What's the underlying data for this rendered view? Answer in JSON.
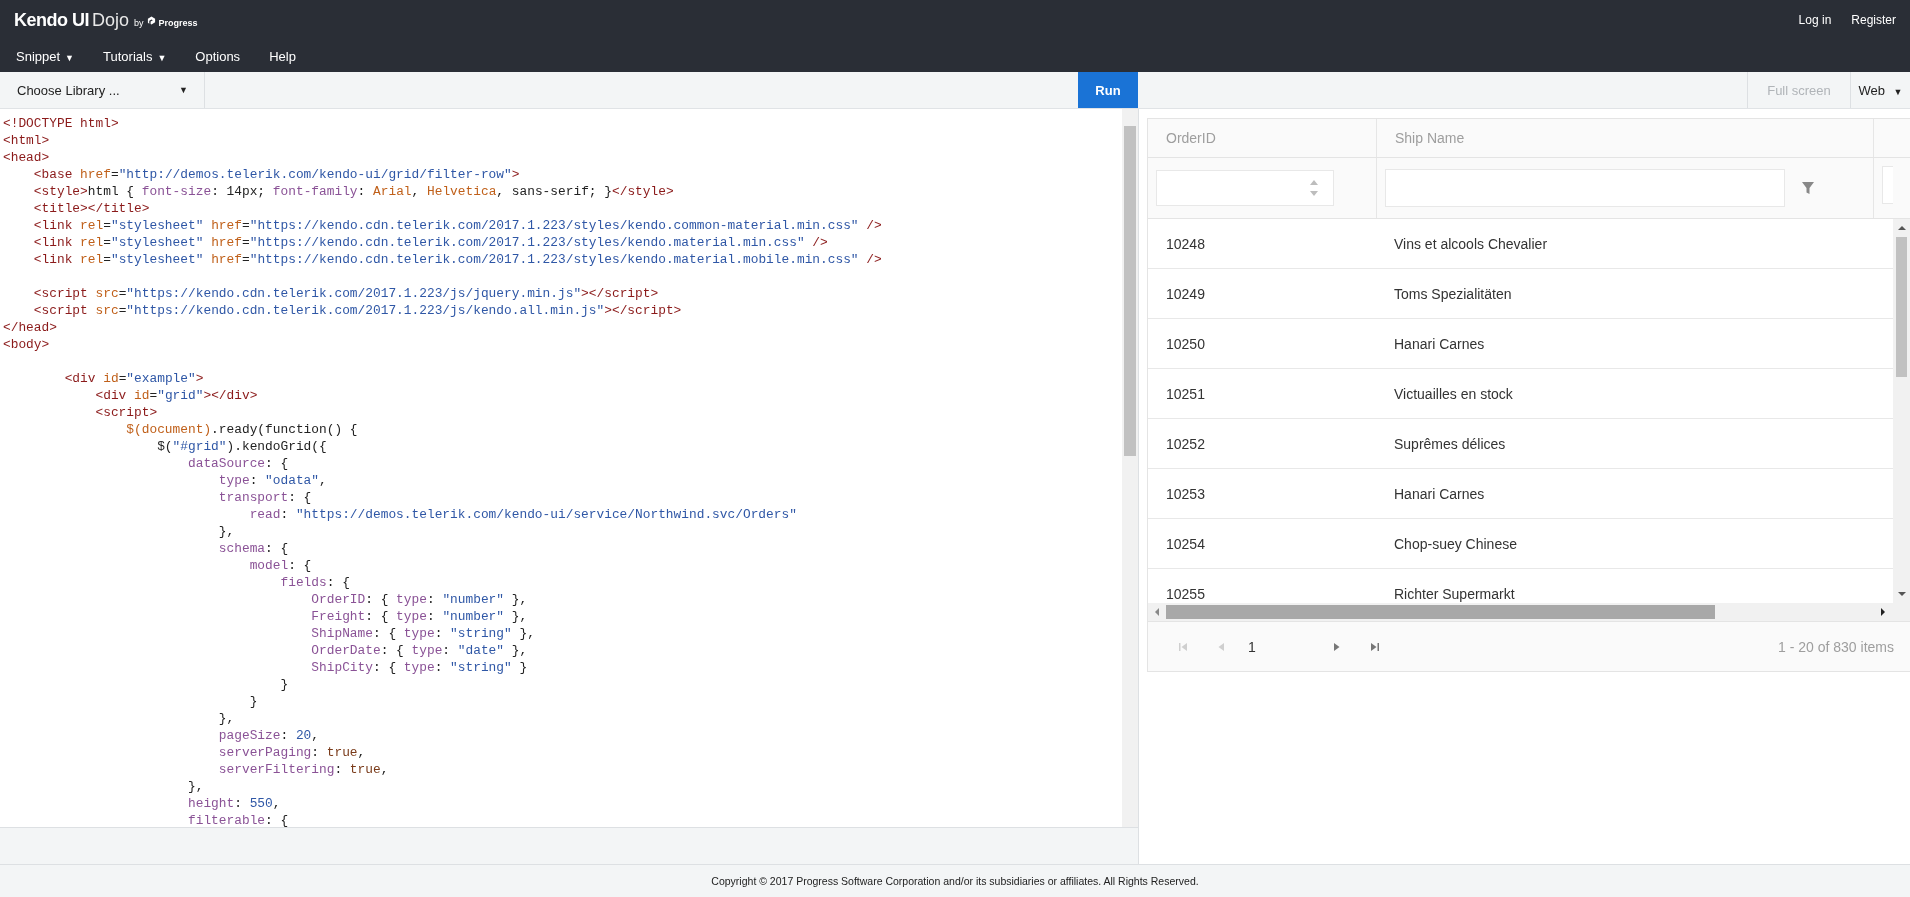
{
  "brand": {
    "name": "Kendo UI",
    "product": "Dojo",
    "by": "by",
    "company": "Progress"
  },
  "account_links": [
    "Log in",
    "Register"
  ],
  "menu": [
    {
      "label": "Snippet",
      "caret": "▼"
    },
    {
      "label": "Tutorials",
      "caret": "▼"
    },
    {
      "label": "Options"
    },
    {
      "label": "Help"
    }
  ],
  "toolbar": {
    "library": {
      "label": "Choose Library ...",
      "caret": "▼"
    },
    "run": "Run",
    "full_screen": {
      "label": "Full screen",
      "disabled": true
    },
    "view": {
      "label": "Web",
      "caret": "▼"
    }
  },
  "code_lines": [
    {
      "tokens": [
        {
          "kind": "tag",
          "text": "<!DOCTYPE html>"
        }
      ]
    },
    {
      "tokens": [
        {
          "kind": "tag",
          "text": "<html>"
        }
      ]
    },
    {
      "tokens": [
        {
          "kind": "tag",
          "text": "<head>"
        }
      ]
    },
    {
      "tokens": [
        {
          "kind": "tag",
          "text": "    <base "
        },
        {
          "kind": "attr",
          "text": "href"
        },
        {
          "kind": "plain",
          "text": "="
        },
        {
          "kind": "str",
          "text": "\"http://demos.telerik.com/kendo-ui/grid/filter-row\""
        },
        {
          "kind": "tag",
          "text": ">"
        }
      ]
    },
    {
      "tokens": [
        {
          "kind": "tag",
          "text": "    <style>"
        },
        {
          "kind": "plain",
          "text": "html { "
        },
        {
          "kind": "prop",
          "text": "font-size"
        },
        {
          "kind": "plain",
          "text": ": 14px; "
        },
        {
          "kind": "prop",
          "text": "font-family"
        },
        {
          "kind": "plain",
          "text": ": "
        },
        {
          "kind": "attr",
          "text": "Arial"
        },
        {
          "kind": "plain",
          "text": ", "
        },
        {
          "kind": "attr",
          "text": "Helvetica"
        },
        {
          "kind": "plain",
          "text": ", sans-serif; }"
        },
        {
          "kind": "tag",
          "text": "</style>"
        }
      ]
    },
    {
      "tokens": [
        {
          "kind": "tag",
          "text": "    <title></title>"
        }
      ]
    },
    {
      "tokens": [
        {
          "kind": "tag",
          "text": "    <link "
        },
        {
          "kind": "attr",
          "text": "rel"
        },
        {
          "kind": "plain",
          "text": "="
        },
        {
          "kind": "str",
          "text": "\"stylesheet\" "
        },
        {
          "kind": "attr",
          "text": "href"
        },
        {
          "kind": "plain",
          "text": "="
        },
        {
          "kind": "str",
          "text": "\"https://kendo.cdn.telerik.com/2017.1.223/styles/kendo.common-material.min.css\""
        },
        {
          "kind": "tag",
          "text": " />"
        }
      ]
    },
    {
      "tokens": [
        {
          "kind": "tag",
          "text": "    <link "
        },
        {
          "kind": "attr",
          "text": "rel"
        },
        {
          "kind": "plain",
          "text": "="
        },
        {
          "kind": "str",
          "text": "\"stylesheet\" "
        },
        {
          "kind": "attr",
          "text": "href"
        },
        {
          "kind": "plain",
          "text": "="
        },
        {
          "kind": "str",
          "text": "\"https://kendo.cdn.telerik.com/2017.1.223/styles/kendo.material.min.css\""
        },
        {
          "kind": "tag",
          "text": " />"
        }
      ]
    },
    {
      "tokens": [
        {
          "kind": "tag",
          "text": "    <link "
        },
        {
          "kind": "attr",
          "text": "rel"
        },
        {
          "kind": "plain",
          "text": "="
        },
        {
          "kind": "str",
          "text": "\"stylesheet\" "
        },
        {
          "kind": "attr",
          "text": "href"
        },
        {
          "kind": "plain",
          "text": "="
        },
        {
          "kind": "str",
          "text": "\"https://kendo.cdn.telerik.com/2017.1.223/styles/kendo.material.mobile.min.css\""
        },
        {
          "kind": "tag",
          "text": " />"
        }
      ]
    },
    {
      "blank_line_before": true,
      "tokens": [
        {
          "kind": "tag",
          "text": "    <script "
        },
        {
          "kind": "attr",
          "text": "src"
        },
        {
          "kind": "plain",
          "text": "="
        },
        {
          "kind": "str",
          "text": "\"https://kendo.cdn.telerik.com/2017.1.223/js/jquery.min.js\""
        },
        {
          "kind": "tag",
          "text": "></script>"
        }
      ]
    },
    {
      "tokens": [
        {
          "kind": "tag",
          "text": "    <script "
        },
        {
          "kind": "attr",
          "text": "src"
        },
        {
          "kind": "plain",
          "text": "="
        },
        {
          "kind": "str",
          "text": "\"https://kendo.cdn.telerik.com/2017.1.223/js/kendo.all.min.js\""
        },
        {
          "kind": "tag",
          "text": "></script>"
        }
      ]
    },
    {
      "tokens": [
        {
          "kind": "tag",
          "text": "</head>"
        }
      ]
    },
    {
      "tokens": [
        {
          "kind": "tag",
          "text": "<body>"
        }
      ]
    },
    {
      "blank_line_before": true,
      "tokens": [
        {
          "kind": "tag",
          "text": "        <div "
        },
        {
          "kind": "attr",
          "text": "id"
        },
        {
          "kind": "plain",
          "text": "="
        },
        {
          "kind": "str",
          "text": "\"example\""
        },
        {
          "kind": "tag",
          "text": ">"
        }
      ]
    },
    {
      "tokens": [
        {
          "kind": "tag",
          "text": "            <div "
        },
        {
          "kind": "attr",
          "text": "id"
        },
        {
          "kind": "plain",
          "text": "="
        },
        {
          "kind": "str",
          "text": "\"grid\""
        },
        {
          "kind": "tag",
          "text": "></div>"
        }
      ]
    },
    {
      "tokens": [
        {
          "kind": "tag",
          "text": "            <script>"
        }
      ]
    },
    {
      "tokens": [
        {
          "kind": "attr",
          "text": "                $(document)"
        },
        {
          "kind": "plain",
          "text": ".ready(function() {"
        }
      ]
    },
    {
      "tokens": [
        {
          "kind": "plain",
          "text": "                    $("
        },
        {
          "kind": "str",
          "text": "\"#grid\""
        },
        {
          "kind": "plain",
          "text": ").kendoGrid({"
        }
      ]
    },
    {
      "tokens": [
        {
          "kind": "prop",
          "text": "                        dataSource"
        },
        {
          "kind": "plain",
          "text": ": {"
        }
      ]
    },
    {
      "tokens": [
        {
          "kind": "prop",
          "text": "                            type"
        },
        {
          "kind": "plain",
          "text": ": "
        },
        {
          "kind": "str",
          "text": "\"odata\""
        },
        {
          "kind": "plain",
          "text": ","
        }
      ]
    },
    {
      "tokens": [
        {
          "kind": "prop",
          "text": "                            transport"
        },
        {
          "kind": "plain",
          "text": ": {"
        }
      ]
    },
    {
      "tokens": [
        {
          "kind": "prop",
          "text": "                                read"
        },
        {
          "kind": "plain",
          "text": ": "
        },
        {
          "kind": "str",
          "text": "\"https://demos.telerik.com/kendo-ui/service/Northwind.svc/Orders\""
        }
      ]
    },
    {
      "tokens": [
        {
          "kind": "plain",
          "text": "                            },"
        }
      ]
    },
    {
      "tokens": [
        {
          "kind": "prop",
          "text": "                            schema"
        },
        {
          "kind": "plain",
          "text": ": {"
        }
      ]
    },
    {
      "tokens": [
        {
          "kind": "prop",
          "text": "                                model"
        },
        {
          "kind": "plain",
          "text": ": {"
        }
      ]
    },
    {
      "tokens": [
        {
          "kind": "prop",
          "text": "                                    fields"
        },
        {
          "kind": "plain",
          "text": ": {"
        }
      ]
    },
    {
      "tokens": [
        {
          "kind": "prop",
          "text": "                                        OrderID"
        },
        {
          "kind": "plain",
          "text": ": { "
        },
        {
          "kind": "prop",
          "text": "type"
        },
        {
          "kind": "plain",
          "text": ": "
        },
        {
          "kind": "str",
          "text": "\"number\""
        },
        {
          "kind": "plain",
          "text": " },"
        }
      ]
    },
    {
      "tokens": [
        {
          "kind": "prop",
          "text": "                                        Freight"
        },
        {
          "kind": "plain",
          "text": ": { "
        },
        {
          "kind": "prop",
          "text": "type"
        },
        {
          "kind": "plain",
          "text": ": "
        },
        {
          "kind": "str",
          "text": "\"number\""
        },
        {
          "kind": "plain",
          "text": " },"
        }
      ]
    },
    {
      "tokens": [
        {
          "kind": "prop",
          "text": "                                        ShipName"
        },
        {
          "kind": "plain",
          "text": ": { "
        },
        {
          "kind": "prop",
          "text": "type"
        },
        {
          "kind": "plain",
          "text": ": "
        },
        {
          "kind": "str",
          "text": "\"string\""
        },
        {
          "kind": "plain",
          "text": " },"
        }
      ]
    },
    {
      "tokens": [
        {
          "kind": "prop",
          "text": "                                        OrderDate"
        },
        {
          "kind": "plain",
          "text": ": { "
        },
        {
          "kind": "prop",
          "text": "type"
        },
        {
          "kind": "plain",
          "text": ": "
        },
        {
          "kind": "str",
          "text": "\"date\""
        },
        {
          "kind": "plain",
          "text": " },"
        }
      ]
    },
    {
      "tokens": [
        {
          "kind": "prop",
          "text": "                                        ShipCity"
        },
        {
          "kind": "plain",
          "text": ": { "
        },
        {
          "kind": "prop",
          "text": "type"
        },
        {
          "kind": "plain",
          "text": ": "
        },
        {
          "kind": "str",
          "text": "\"string\""
        },
        {
          "kind": "plain",
          "text": " }"
        }
      ]
    },
    {
      "tokens": [
        {
          "kind": "plain",
          "text": "                                    }"
        }
      ]
    },
    {
      "tokens": [
        {
          "kind": "plain",
          "text": "                                }"
        }
      ]
    },
    {
      "tokens": [
        {
          "kind": "plain",
          "text": "                            },"
        }
      ]
    },
    {
      "tokens": [
        {
          "kind": "prop",
          "text": "                            pageSize"
        },
        {
          "kind": "plain",
          "text": ": "
        },
        {
          "kind": "num",
          "text": "20"
        },
        {
          "kind": "plain",
          "text": ","
        }
      ]
    },
    {
      "tokens": [
        {
          "kind": "prop",
          "text": "                            serverPaging"
        },
        {
          "kind": "plain",
          "text": ": "
        },
        {
          "kind": "val",
          "text": "true"
        },
        {
          "kind": "plain",
          "text": ","
        }
      ]
    },
    {
      "tokens": [
        {
          "kind": "prop",
          "text": "                            serverFiltering"
        },
        {
          "kind": "plain",
          "text": ": "
        },
        {
          "kind": "val",
          "text": "true"
        },
        {
          "kind": "plain",
          "text": ","
        }
      ]
    },
    {
      "tokens": [
        {
          "kind": "plain",
          "text": "                        },"
        }
      ]
    },
    {
      "tokens": [
        {
          "kind": "prop",
          "text": "                        height"
        },
        {
          "kind": "plain",
          "text": ": "
        },
        {
          "kind": "num",
          "text": "550"
        },
        {
          "kind": "plain",
          "text": ","
        }
      ]
    },
    {
      "tokens": [
        {
          "kind": "prop",
          "text": "                        filterable"
        },
        {
          "kind": "plain",
          "text": ": {"
        }
      ]
    }
  ],
  "grid": {
    "columns": [
      "OrderID",
      "Ship Name"
    ],
    "rows": [
      {
        "order_id": "10248",
        "ship_name": "Vins et alcools Chevalier"
      },
      {
        "order_id": "10249",
        "ship_name": "Toms Spezialitäten"
      },
      {
        "order_id": "10250",
        "ship_name": "Hanari Carnes"
      },
      {
        "order_id": "10251",
        "ship_name": "Victuailles en stock"
      },
      {
        "order_id": "10252",
        "ship_name": "Suprêmes délices"
      },
      {
        "order_id": "10253",
        "ship_name": "Hanari Carnes"
      },
      {
        "order_id": "10254",
        "ship_name": "Chop-suey Chinese"
      },
      {
        "order_id": "10255",
        "ship_name": "Richter Supermarkt"
      }
    ],
    "pager": {
      "buttons": [
        {
          "kind": "first",
          "disabled": true
        },
        {
          "kind": "prev",
          "disabled": true
        },
        {
          "kind": "next",
          "disabled": false
        },
        {
          "kind": "last",
          "disabled": false
        }
      ],
      "page": "1",
      "info": "1 - 20 of 830 items"
    }
  },
  "footer": "Copyright © 2017 Progress Software Corporation and/or its subsidiaries or affiliates. All Rights Reserved."
}
